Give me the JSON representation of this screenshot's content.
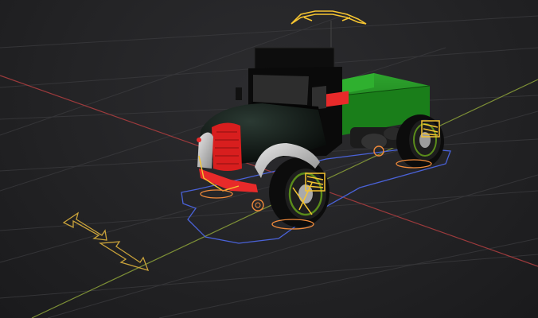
{
  "viewport": {
    "mode": "3d-rig-view",
    "object": "truck",
    "colors": {
      "background": "#242426",
      "grid_line": "#3b3b3e",
      "axis_x": "#a8403f",
      "axis_y": "#8a9a3a",
      "rig_controls": "#f5c431",
      "rig_orange": "#f08a3a",
      "rig_blue": "#4a62d8",
      "cab_body": "#0b0b0b",
      "cargo_bed": "#1f8b1f",
      "grille": "#e12020",
      "fender": "#c9c9c9",
      "wheel_hub": "#5a8c1a"
    },
    "icons": {
      "move_arrow": "move-arrow-icon",
      "root_arc": "root-arc-control-icon",
      "steering": "steering-control-icon"
    }
  }
}
